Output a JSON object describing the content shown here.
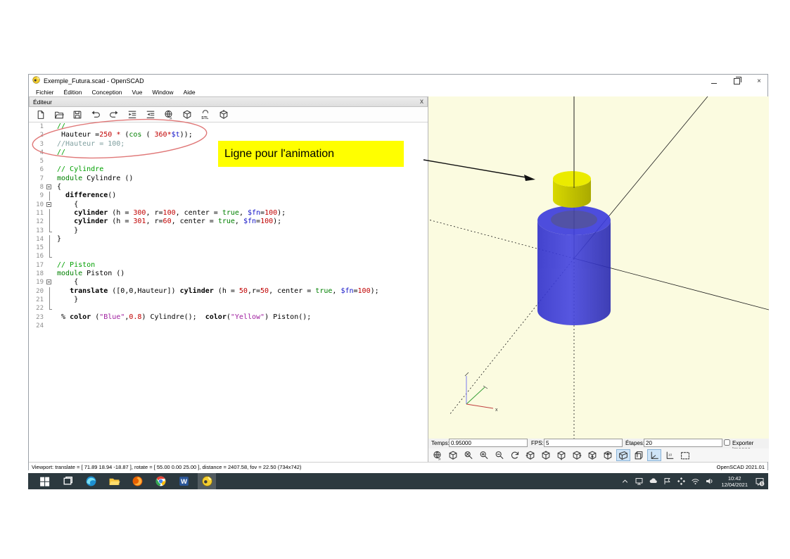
{
  "window": {
    "title": "Exemple_Futura.scad - OpenSCAD",
    "menu": [
      "Fichier",
      "Édition",
      "Conception",
      "Vue",
      "Window",
      "Aide"
    ],
    "close_glyph": "×"
  },
  "editor": {
    "panel_title": "Éditeur",
    "panel_close_glyph": "x",
    "toolbar_icons": [
      "new-file",
      "open-file",
      "save-file",
      "undo",
      "redo",
      "indent",
      "unindent",
      "preview",
      "render",
      "export-stl",
      "measure-cube"
    ],
    "lines": [
      {
        "n": "1",
        "fold": "",
        "segs": [
          [
            "m",
            "//"
          ]
        ]
      },
      {
        "n": "2",
        "fold": "",
        "segs": [
          [
            "p",
            " Hauteur ="
          ],
          [
            "n",
            "250"
          ],
          [
            "p",
            " "
          ],
          [
            "n",
            "*"
          ],
          [
            "p",
            " ("
          ],
          [
            "k",
            "cos"
          ],
          [
            "p",
            " ( "
          ],
          [
            "n",
            "360"
          ],
          [
            "n",
            "*"
          ],
          [
            "v",
            "$t"
          ],
          [
            "p",
            "));"
          ]
        ]
      },
      {
        "n": "3",
        "fold": "",
        "segs": [
          [
            "m2",
            "//Hauteur = 100;"
          ]
        ]
      },
      {
        "n": "4",
        "fold": "",
        "segs": [
          [
            "m",
            "//"
          ]
        ]
      },
      {
        "n": "5",
        "fold": "",
        "segs": []
      },
      {
        "n": "6",
        "fold": "",
        "segs": [
          [
            "m",
            "// Cylindre"
          ]
        ]
      },
      {
        "n": "7",
        "fold": "",
        "segs": [
          [
            "k",
            "module"
          ],
          [
            "p",
            " Cylindre ()"
          ]
        ]
      },
      {
        "n": "8",
        "fold": "box",
        "segs": [
          [
            "p",
            "{"
          ]
        ]
      },
      {
        "n": "9",
        "fold": "line",
        "segs": [
          [
            "p",
            "  "
          ],
          [
            "b",
            "difference"
          ],
          [
            "p",
            "()"
          ]
        ]
      },
      {
        "n": "10",
        "fold": "box",
        "segs": [
          [
            "p",
            "    {"
          ]
        ]
      },
      {
        "n": "11",
        "fold": "line",
        "segs": [
          [
            "p",
            "    "
          ],
          [
            "b",
            "cylinder"
          ],
          [
            "p",
            " (h = "
          ],
          [
            "n",
            "300"
          ],
          [
            "p",
            ", r="
          ],
          [
            "n",
            "100"
          ],
          [
            "p",
            ", center = "
          ],
          [
            "k",
            "true"
          ],
          [
            "p",
            ", "
          ],
          [
            "v",
            "$fn"
          ],
          [
            "p",
            "="
          ],
          [
            "n",
            "100"
          ],
          [
            "p",
            ");"
          ]
        ]
      },
      {
        "n": "12",
        "fold": "line",
        "segs": [
          [
            "p",
            "    "
          ],
          [
            "b",
            "cylinder"
          ],
          [
            "p",
            " (h = "
          ],
          [
            "n",
            "301"
          ],
          [
            "p",
            ", r="
          ],
          [
            "n",
            "60"
          ],
          [
            "p",
            ", center = "
          ],
          [
            "k",
            "true"
          ],
          [
            "p",
            ", "
          ],
          [
            "v",
            "$fn"
          ],
          [
            "p",
            "="
          ],
          [
            "n",
            "100"
          ],
          [
            "p",
            ");"
          ]
        ]
      },
      {
        "n": "13",
        "fold": "end",
        "segs": [
          [
            "p",
            "    }"
          ]
        ]
      },
      {
        "n": "14",
        "fold": "line",
        "segs": [
          [
            "p",
            "}"
          ]
        ]
      },
      {
        "n": "15",
        "fold": "line",
        "segs": []
      },
      {
        "n": "16",
        "fold": "end",
        "segs": []
      },
      {
        "n": "17",
        "fold": "",
        "segs": [
          [
            "m",
            "// Piston"
          ]
        ]
      },
      {
        "n": "18",
        "fold": "",
        "segs": [
          [
            "k",
            "module"
          ],
          [
            "p",
            " Piston ()"
          ]
        ]
      },
      {
        "n": "19",
        "fold": "box",
        "segs": [
          [
            "p",
            "    {"
          ]
        ]
      },
      {
        "n": "20",
        "fold": "line",
        "segs": [
          [
            "p",
            "   "
          ],
          [
            "b",
            "translate"
          ],
          [
            "p",
            " ([0,0,Hauteur]) "
          ],
          [
            "b",
            "cylinder"
          ],
          [
            "p",
            " (h = "
          ],
          [
            "n",
            "50"
          ],
          [
            "p",
            ",r="
          ],
          [
            "n",
            "50"
          ],
          [
            "p",
            ", center = "
          ],
          [
            "k",
            "true"
          ],
          [
            "p",
            ", "
          ],
          [
            "v",
            "$fn"
          ],
          [
            "p",
            "="
          ],
          [
            "n",
            "100"
          ],
          [
            "p",
            ");"
          ]
        ]
      },
      {
        "n": "21",
        "fold": "line",
        "segs": [
          [
            "p",
            "    }"
          ]
        ]
      },
      {
        "n": "22",
        "fold": "end",
        "segs": []
      },
      {
        "n": "23",
        "fold": "",
        "segs": [
          [
            "p",
            " % "
          ],
          [
            "b",
            "color"
          ],
          [
            "p",
            " ("
          ],
          [
            "s",
            "\"Blue\""
          ],
          [
            "p",
            ","
          ],
          [
            "n",
            "0.8"
          ],
          [
            "p",
            ") Cylindre();  "
          ],
          [
            "b",
            "color"
          ],
          [
            "p",
            "("
          ],
          [
            "s",
            "\"Yellow\""
          ],
          [
            "p",
            ") Piston();"
          ]
        ]
      },
      {
        "n": "24",
        "fold": "",
        "segs": []
      }
    ]
  },
  "annotation": {
    "label": "Ligne pour l'animation"
  },
  "viewport": {
    "axis_x_label": "x",
    "toolbar_icons": [
      "preview",
      "render",
      "zoom-all",
      "zoom-in",
      "zoom-out",
      "reset-view",
      "view-right",
      "view-top",
      "view-bottom",
      "view-left",
      "view-front",
      "view-back",
      "perspective",
      "orthogonal",
      "show-axes",
      "show-scale-markers",
      "view-all"
    ],
    "toolbar_highlighted": [
      "perspective",
      "show-axes"
    ]
  },
  "animbar": {
    "temps_label": "Temps:",
    "temps_value": "0.95000",
    "fps_label": "FPS:",
    "fps_value": "5",
    "etapes_label": "Étapes:",
    "etapes_value": "20",
    "export_label": "Exporter images"
  },
  "statusbar": {
    "left": "Viewport: translate = [ 71.89 18.94 -18.87 ], rotate = [ 55.00 0.00 25.00 ], distance = 2407.58, fov = 22.50 (734x742)",
    "right": "OpenSCAD 2021.01"
  },
  "taskbar": {
    "apps": [
      "start",
      "task-view",
      "edge",
      "file-explorer",
      "firefox",
      "chrome",
      "word",
      "openscad"
    ],
    "active_app": "openscad",
    "tray_icons": [
      "hidden-icons-chevron",
      "device",
      "onedrive-cloud",
      "snip",
      "teams",
      "wifi",
      "volume"
    ],
    "clock_time": "10:42",
    "clock_date": "12/04/2021",
    "notification_badge": "5"
  },
  "colors": {
    "viewport_bg": "#fbfbe0",
    "annotation_bg": "#ffff00",
    "ellipse_stroke": "#e07878",
    "taskbar_bg": "#2c393f",
    "highlight_bg": "#cfe4f7",
    "model_blue_top": "#3b3bdd",
    "model_blue_left": "#3030cc",
    "model_blue_mid": "#4444e0",
    "model_blue_right": "#2a2ab0",
    "model_hole": "#40409f",
    "model_yellow_top": "#ebeb00",
    "model_yellow_left": "#d8d800",
    "model_yellow_right": "#aaaa00"
  }
}
